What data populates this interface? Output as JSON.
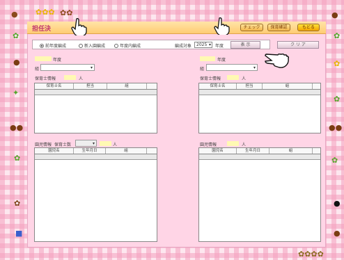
{
  "window": {
    "title": "担任決"
  },
  "toolbar": {
    "check_label": "チェック",
    "report_label": "保育確認",
    "back_label": "もどる"
  },
  "options": {
    "radios": [
      {
        "label": "前年度編成",
        "selected": true
      },
      {
        "label": "新入園編成",
        "selected": false
      },
      {
        "label": "年度内編成",
        "selected": false
      }
    ],
    "target_year_label": "編成対象",
    "target_year_value": "2025",
    "target_year_suffix": "年度",
    "display_button": "表 示",
    "clear_button": "ク リ ア"
  },
  "left": {
    "year_suffix": "年度",
    "class_label": "組",
    "teachers_label": "保育士情報",
    "teachers_unit": "人",
    "teacher_columns": [
      "保育士名",
      "担当",
      "組"
    ],
    "children_label": "園児情報",
    "teachers_count_label": "保育士数",
    "children_unit": "人",
    "children_columns": [
      "園児名",
      "生年月日",
      "組"
    ]
  },
  "right": {
    "year_suffix": "年度",
    "class_label": "組",
    "teachers_label": "保育士情報",
    "teachers_unit": "人",
    "teacher_columns": [
      "保育士名",
      "担当",
      "組"
    ],
    "children_label": "園児情報",
    "children_unit": "人",
    "children_columns": [
      "園児名",
      "生年月日",
      "組"
    ]
  },
  "colors": {
    "accent": "#c0376e",
    "panel": "#ffd5e6",
    "title_bar": "#ffcc73"
  }
}
